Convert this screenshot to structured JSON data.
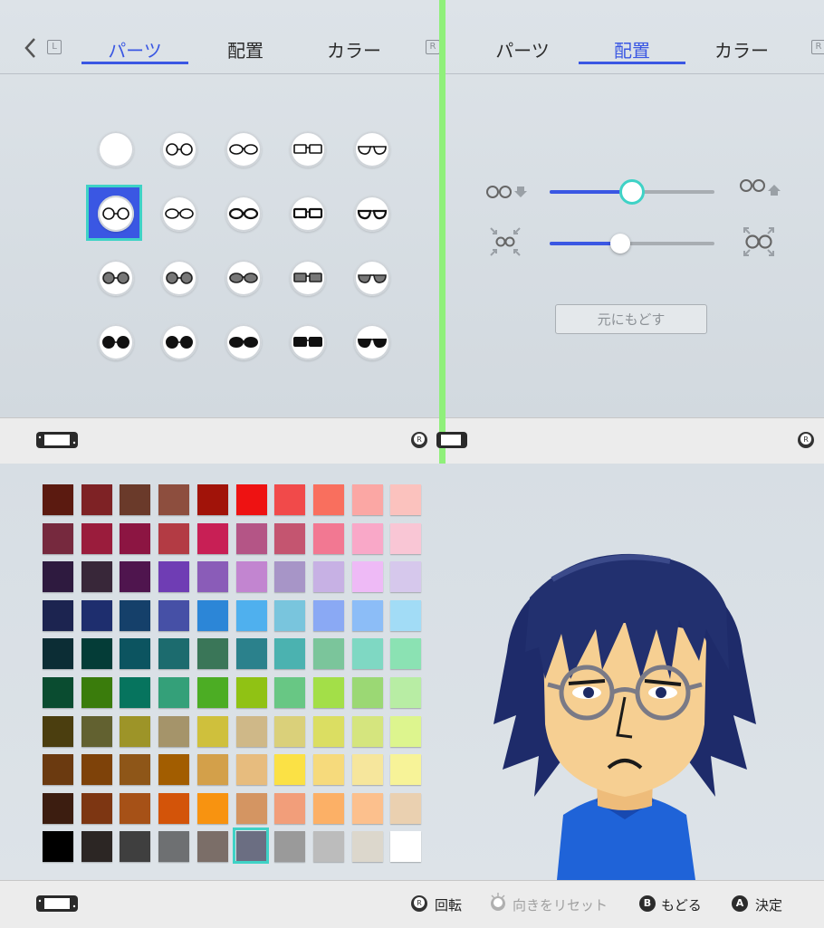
{
  "left_panel": {
    "tabs": [
      {
        "label": "パーツ",
        "active": true
      },
      {
        "label": "配置",
        "active": false
      },
      {
        "label": "カラー",
        "active": false
      }
    ],
    "l_key": "L",
    "r_key": "R"
  },
  "right_panel": {
    "tabs": [
      {
        "label": "パーツ",
        "active": false
      },
      {
        "label": "配置",
        "active": true
      },
      {
        "label": "カラー",
        "active": false
      }
    ],
    "reset_label": "元にもどす",
    "sliders": [
      {
        "name": "position",
        "value": 0.5
      },
      {
        "name": "size",
        "value": 0.43
      }
    ]
  },
  "glasses_grid": {
    "rows": 4,
    "cols": 5,
    "selected_index": 5,
    "items": [
      "none",
      "round-thin",
      "oval-thin",
      "rect-thin",
      "half-rim",
      "round-selected",
      "round-small",
      "oval-bold",
      "rect-bold",
      "half-rim-bold",
      "round-tint",
      "aviator-tint",
      "oval-tint",
      "rect-tint",
      "half-rim-tint",
      "round-dark",
      "wrap-dark",
      "oval-dark",
      "rect-dark",
      "half-rim-dark"
    ]
  },
  "palette": {
    "rows": [
      [
        "#5b1a10",
        "#7e2225",
        "#6a3a2a",
        "#8d4e3e",
        "#a11309",
        "#ee1212",
        "#f14a4a",
        "#f96f5e",
        "#fba7a4",
        "#fbc2be"
      ],
      [
        "#76293e",
        "#9a1c3c",
        "#8c1542",
        "#b33b44",
        "#c81f55",
        "#b45586",
        "#c45570",
        "#f27892",
        "#f9a8c8",
        "#f9c6d5"
      ],
      [
        "#2e1a3f",
        "#382739",
        "#4f154e",
        "#6f3db4",
        "#8a5cb8",
        "#c285d0",
        "#a795c7",
        "#c7b1e4",
        "#eebaf6",
        "#d6c8ec"
      ],
      [
        "#1c2450",
        "#1e2e6e",
        "#15406a",
        "#4650a6",
        "#2c86d7",
        "#4fb0ee",
        "#79c5dd",
        "#8aa9f4",
        "#8cbdf7",
        "#a2dcf6"
      ],
      [
        "#0c2d35",
        "#043c37",
        "#0c5460",
        "#1c6b6e",
        "#3a7658",
        "#2b818c",
        "#4bb2b0",
        "#7bc59b",
        "#7fd8c3",
        "#8be2b3"
      ],
      [
        "#0a4c30",
        "#3a7c0c",
        "#06745e",
        "#34a079",
        "#4cad24",
        "#90c214",
        "#68c784",
        "#a3df48",
        "#9bd874",
        "#b8eda4"
      ],
      [
        "#4b3e0f",
        "#626130",
        "#9d9428",
        "#a5946a",
        "#cfc03c",
        "#cfb888",
        "#dad07a",
        "#dbde62",
        "#d5e57e",
        "#ddf58e"
      ],
      [
        "#6b3a10",
        "#7e4209",
        "#8e5618",
        "#a25d00",
        "#d3a04a",
        "#e7bc7e",
        "#fbe145",
        "#f6da7c",
        "#f6e69c",
        "#f7f398"
      ],
      [
        "#3c1d10",
        "#7d3612",
        "#a65117",
        "#d35409",
        "#f89310",
        "#d49562",
        "#f29e7a",
        "#fcb066",
        "#fcc08d",
        "#ead0b0"
      ],
      [
        "#000000",
        "#2c2624",
        "#3f3f3f",
        "#6e7072",
        "#7b6e68",
        "#6b6e82",
        "#9a9a9a",
        "#bcbcbc",
        "#dcd7cc",
        "#ffffff"
      ]
    ],
    "selected": {
      "row": 9,
      "col": 5
    }
  },
  "hints": {
    "rotate": "回転",
    "reset_orientation": "向きをリセット",
    "back": "もどる",
    "confirm": "決定",
    "b_key": "B",
    "a_key": "A",
    "r_stick": "R"
  },
  "colors": {
    "accent": "#3a57e3",
    "selection": "#3fd2c6",
    "hair": "#1e2b6a",
    "shirt": "#1f63d8",
    "skin": "#f6cf92"
  }
}
